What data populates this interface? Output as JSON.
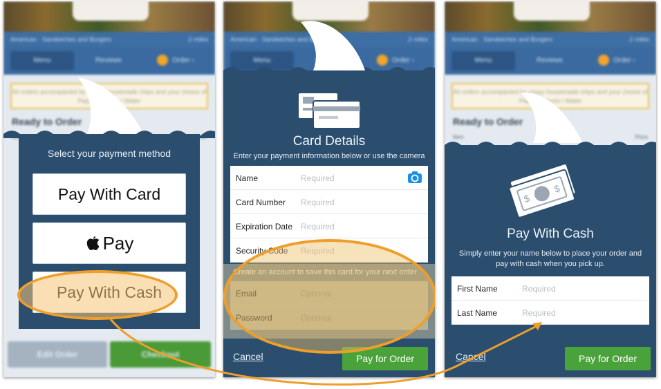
{
  "background_app": {
    "cuisine": "American · Sandwiches and Burgers",
    "distance": ".2 miles",
    "tabs": [
      "Menu",
      "Reviews",
      "Order"
    ],
    "notice": "All orders accompanied by crispy housemade chips and your choice of Pepsi products / Water",
    "ready_heading": "Ready to Order",
    "col_item": "Item",
    "col_price": "Price",
    "edit_order": "Edit Order",
    "checkout": "Checkout"
  },
  "payment_method": {
    "title": "Select your payment method",
    "pay_card": "Pay With Card",
    "apple_pay": "Pay",
    "pay_cash": "Pay With Cash"
  },
  "card_details": {
    "title": "Card Details",
    "subtitle": "Enter your payment information below or use the camera",
    "fields": [
      {
        "label": "Name",
        "placeholder": "Required"
      },
      {
        "label": "Card Number",
        "placeholder": "Required"
      },
      {
        "label": "Expiration Date",
        "placeholder": "Required"
      },
      {
        "label": "Security Code",
        "placeholder": "Required"
      }
    ],
    "save_text": "Create an account to save this card for your next order",
    "account_fields": [
      {
        "label": "Email",
        "placeholder": "Optional"
      },
      {
        "label": "Password",
        "placeholder": "Optional"
      }
    ],
    "cancel": "Cancel",
    "pay": "Pay for Order"
  },
  "pay_cash": {
    "title": "Pay With Cash",
    "subtitle": "Simply enter your name below to place your order and pay with cash when you pick up.",
    "fields": [
      {
        "label": "First Name",
        "placeholder": "Required"
      },
      {
        "label": "Last Name",
        "placeholder": "Required"
      }
    ],
    "cancel": "Cancel",
    "pay": "Pay for Order"
  },
  "colors": {
    "panel": "#2b4d6e",
    "accent_orange": "#ee9f2b",
    "pay_green": "#4aa33a"
  }
}
